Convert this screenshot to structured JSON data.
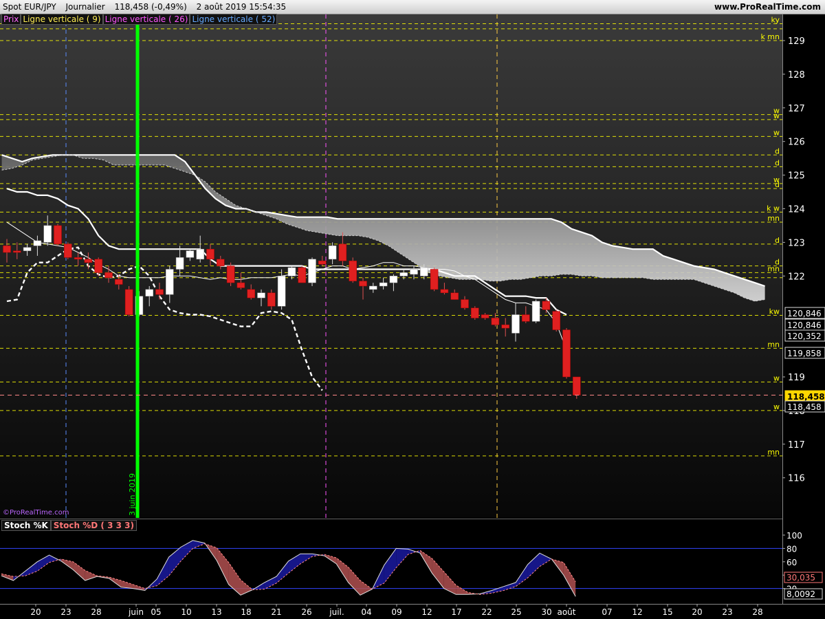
{
  "title_bar": {
    "symbol": "Spot EUR/JPY",
    "period": "Journalier",
    "price_change": "118,458 (-0,49%)",
    "datetime": "2 août 2019 15:54:35",
    "site": "www.ProRealTime.com"
  },
  "legend": {
    "prix": "Prix",
    "line9": "Ligne verticale ( 9)",
    "line26": "Ligne verticale ( 26)",
    "line52": "Ligne verticale ( 52)"
  },
  "watermark": "©ProRealTime.com",
  "vertical_label": "3 juin 2019",
  "stoch_legend": {
    "k": "Stoch %K",
    "d": "Stoch %D ( 3 3 3)"
  },
  "colors": {
    "up_candle": "#ffffff",
    "down_candle": "#e02020",
    "level_line": "#ffff00",
    "green_marker": "#00ff00",
    "stoch_k": "#3355ff",
    "stoch_d": "#ff7777"
  },
  "chart_data": [
    {
      "type": "candlestick",
      "title": "Spot EUR/JPY",
      "ylim": [
        115.1,
        129.8
      ],
      "y_ticks": [
        116,
        117,
        118,
        119,
        122,
        123,
        124,
        125,
        126,
        127,
        128,
        129
      ],
      "x_ticks": [
        "20",
        "23",
        "28",
        "juin",
        "05",
        "10",
        "13",
        "18",
        "21",
        "26",
        "juil.",
        "04",
        "09",
        "12",
        "17",
        "22",
        "25",
        "30",
        "août",
        "07",
        "12",
        "15",
        "20",
        "23",
        "28"
      ],
      "price_boxes": [
        {
          "value": "120,846",
          "style": "outline"
        },
        {
          "value": "120,846",
          "style": "outline"
        },
        {
          "value": "120,352",
          "style": "outline"
        },
        {
          "value": "119,858",
          "style": "outline"
        },
        {
          "value": "118,458",
          "style": "highlight"
        },
        {
          "value": "118,458",
          "style": "outline"
        }
      ],
      "levels": [
        {
          "value": 129.5,
          "label": "ky"
        },
        {
          "value": 129.35,
          "label": ""
        },
        {
          "value": 129.0,
          "label": "k mn"
        },
        {
          "value": 126.8,
          "label": "w"
        },
        {
          "value": 126.65,
          "label": "w"
        },
        {
          "value": 126.15,
          "label": "w"
        },
        {
          "value": 125.6,
          "label": "d"
        },
        {
          "value": 125.25,
          "label": "d"
        },
        {
          "value": 124.75,
          "label": "w"
        },
        {
          "value": 124.6,
          "label": "d"
        },
        {
          "value": 123.9,
          "label": "k w"
        },
        {
          "value": 123.6,
          "label": "mn"
        },
        {
          "value": 122.95,
          "label": "d"
        },
        {
          "value": 122.3,
          "label": "d"
        },
        {
          "value": 122.1,
          "label": "mn"
        },
        {
          "value": 121.95,
          "label": ""
        },
        {
          "value": 120.83,
          "label": "kw"
        },
        {
          "value": 119.85,
          "label": "mn"
        },
        {
          "value": 118.85,
          "label": "w"
        },
        {
          "value": 118.0,
          "label": "w"
        },
        {
          "value": 116.65,
          "label": "mn"
        }
      ],
      "candles": [
        {
          "o": 122.9,
          "h": 123.1,
          "l": 122.4,
          "c": 122.7
        },
        {
          "o": 122.75,
          "h": 123.0,
          "l": 122.5,
          "c": 122.7
        },
        {
          "o": 122.75,
          "h": 122.95,
          "l": 122.6,
          "c": 122.85
        },
        {
          "o": 122.9,
          "h": 123.2,
          "l": 122.6,
          "c": 123.05
        },
        {
          "o": 123.0,
          "h": 123.8,
          "l": 122.9,
          "c": 123.5
        },
        {
          "o": 123.5,
          "h": 123.55,
          "l": 122.9,
          "c": 122.95
        },
        {
          "o": 122.95,
          "h": 123.0,
          "l": 122.5,
          "c": 122.55
        },
        {
          "o": 122.55,
          "h": 122.7,
          "l": 122.3,
          "c": 122.5
        },
        {
          "o": 122.5,
          "h": 122.7,
          "l": 122.2,
          "c": 122.4
        },
        {
          "o": 122.5,
          "h": 122.55,
          "l": 122.0,
          "c": 122.1
        },
        {
          "o": 122.1,
          "h": 122.3,
          "l": 121.8,
          "c": 121.95
        },
        {
          "o": 121.9,
          "h": 122.05,
          "l": 121.6,
          "c": 121.75
        },
        {
          "o": 121.6,
          "h": 121.7,
          "l": 120.8,
          "c": 120.85
        },
        {
          "o": 120.85,
          "h": 121.55,
          "l": 120.8,
          "c": 121.4
        },
        {
          "o": 121.4,
          "h": 121.7,
          "l": 121.1,
          "c": 121.6
        },
        {
          "o": 121.6,
          "h": 121.8,
          "l": 121.3,
          "c": 121.45
        },
        {
          "o": 121.45,
          "h": 122.3,
          "l": 121.2,
          "c": 122.2
        },
        {
          "o": 122.2,
          "h": 122.9,
          "l": 122.0,
          "c": 122.55
        },
        {
          "o": 122.55,
          "h": 122.8,
          "l": 122.45,
          "c": 122.75
        },
        {
          "o": 122.5,
          "h": 123.2,
          "l": 122.4,
          "c": 122.8
        },
        {
          "o": 122.8,
          "h": 122.95,
          "l": 122.3,
          "c": 122.5
        },
        {
          "o": 122.5,
          "h": 122.6,
          "l": 122.2,
          "c": 122.3
        },
        {
          "o": 122.3,
          "h": 122.4,
          "l": 121.7,
          "c": 121.8
        },
        {
          "o": 121.8,
          "h": 122.1,
          "l": 121.6,
          "c": 121.65
        },
        {
          "o": 121.6,
          "h": 121.75,
          "l": 121.3,
          "c": 121.35
        },
        {
          "o": 121.35,
          "h": 121.6,
          "l": 121.1,
          "c": 121.5
        },
        {
          "o": 121.5,
          "h": 121.6,
          "l": 121.0,
          "c": 121.1
        },
        {
          "o": 121.1,
          "h": 122.2,
          "l": 121.0,
          "c": 122.0
        },
        {
          "o": 122.0,
          "h": 122.3,
          "l": 121.9,
          "c": 122.25
        },
        {
          "o": 122.25,
          "h": 122.3,
          "l": 121.8,
          "c": 121.8
        },
        {
          "o": 121.8,
          "h": 122.55,
          "l": 121.7,
          "c": 122.5
        },
        {
          "o": 122.45,
          "h": 122.6,
          "l": 122.3,
          "c": 122.35
        },
        {
          "o": 122.5,
          "h": 123.0,
          "l": 122.35,
          "c": 122.9
        },
        {
          "o": 122.95,
          "h": 123.3,
          "l": 122.3,
          "c": 122.45
        },
        {
          "o": 122.45,
          "h": 122.55,
          "l": 121.8,
          "c": 121.85
        },
        {
          "o": 121.85,
          "h": 121.95,
          "l": 121.3,
          "c": 121.7
        },
        {
          "o": 121.6,
          "h": 121.8,
          "l": 121.5,
          "c": 121.7
        },
        {
          "o": 121.7,
          "h": 121.95,
          "l": 121.6,
          "c": 121.8
        },
        {
          "o": 121.8,
          "h": 122.05,
          "l": 121.55,
          "c": 122.0
        },
        {
          "o": 122.0,
          "h": 122.2,
          "l": 121.9,
          "c": 122.1
        },
        {
          "o": 122.05,
          "h": 122.3,
          "l": 121.9,
          "c": 122.2
        },
        {
          "o": 122.0,
          "h": 122.35,
          "l": 121.9,
          "c": 122.25
        },
        {
          "o": 122.2,
          "h": 122.25,
          "l": 121.55,
          "c": 121.6
        },
        {
          "o": 121.6,
          "h": 121.8,
          "l": 121.45,
          "c": 121.5
        },
        {
          "o": 121.5,
          "h": 121.6,
          "l": 121.3,
          "c": 121.3
        },
        {
          "o": 121.3,
          "h": 121.4,
          "l": 121.0,
          "c": 121.05
        },
        {
          "o": 121.05,
          "h": 121.1,
          "l": 120.7,
          "c": 120.75
        },
        {
          "o": 120.85,
          "h": 120.9,
          "l": 120.7,
          "c": 120.75
        },
        {
          "o": 120.75,
          "h": 120.9,
          "l": 120.5,
          "c": 120.55
        },
        {
          "o": 120.55,
          "h": 120.75,
          "l": 120.2,
          "c": 120.45
        },
        {
          "o": 120.3,
          "h": 121.2,
          "l": 120.05,
          "c": 120.85
        },
        {
          "o": 120.85,
          "h": 121.1,
          "l": 120.6,
          "c": 120.65
        },
        {
          "o": 120.65,
          "h": 121.3,
          "l": 120.6,
          "c": 121.25
        },
        {
          "o": 121.25,
          "h": 121.35,
          "l": 120.9,
          "c": 121.0
        },
        {
          "o": 120.95,
          "h": 121.0,
          "l": 120.35,
          "c": 120.4
        },
        {
          "o": 120.4,
          "h": 120.45,
          "l": 118.95,
          "c": 119.0
        },
        {
          "o": 119.0,
          "h": 119.0,
          "l": 118.35,
          "c": 118.458
        }
      ]
    },
    {
      "type": "line",
      "title": "Stoch %K / Stoch %D ( 3 3 3)",
      "ylim": [
        0,
        100
      ],
      "y_ticks": [
        20,
        40,
        60,
        80,
        100
      ],
      "last_values": [
        {
          "value": "30,035",
          "style": "red"
        },
        {
          "value": "8,0092",
          "style": "outline"
        }
      ],
      "series": [
        {
          "name": "Stoch %K",
          "values": [
            39,
            32,
            46,
            60,
            70,
            61,
            48,
            32,
            38,
            35,
            22,
            20,
            17,
            34,
            67,
            82,
            92,
            88,
            62,
            26,
            10,
            18,
            29,
            38,
            61,
            72,
            72,
            69,
            57,
            29,
            10,
            19,
            55,
            80,
            79,
            73,
            43,
            20,
            11,
            11,
            12,
            17,
            23,
            29,
            56,
            73,
            64,
            40,
            8
          ]
        },
        {
          "value_note": "",
          "name": "Stoch %D",
          "values": [
            42,
            38,
            39,
            46,
            59,
            64,
            60,
            47,
            39,
            37,
            32,
            26,
            20,
            24,
            39,
            61,
            80,
            87,
            81,
            59,
            33,
            18,
            19,
            28,
            43,
            57,
            68,
            71,
            66,
            52,
            32,
            19,
            28,
            51,
            71,
            77,
            65,
            45,
            25,
            14,
            11,
            13,
            17,
            23,
            36,
            53,
            64,
            59,
            30
          ]
        }
      ]
    }
  ]
}
